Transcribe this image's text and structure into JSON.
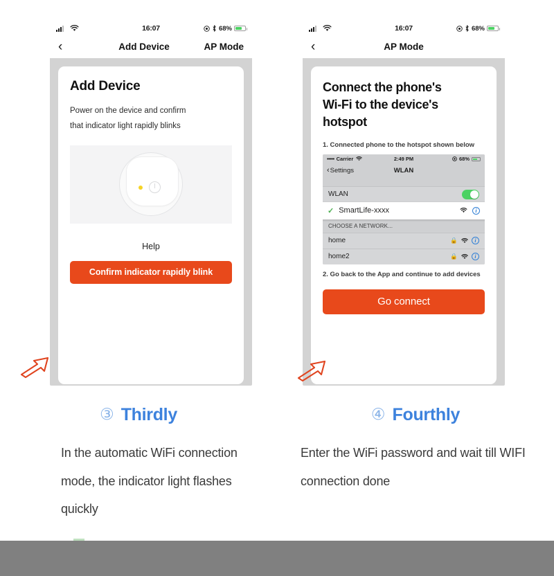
{
  "left_phone": {
    "status_bar": {
      "time": "16:07",
      "battery_text": "68%",
      "signal_icon": "signal-bars-icon",
      "wifi_icon": "wifi-icon",
      "location_icon": "location-icon",
      "bluetooth_icon": "bluetooth-icon",
      "battery_icon": "battery-icon"
    },
    "nav": {
      "back_icon": "chevron-left-icon",
      "title": "Add Device",
      "action": "AP Mode"
    },
    "card": {
      "title": "Add Device",
      "subtitle_line1": "Power on the device and confirm",
      "subtitle_line2": "that indicator light rapidly blinks",
      "device_image_alt": "smart-device-illustration",
      "help_label": "Help",
      "cta_label": "Confirm indicator rapidly blink"
    }
  },
  "right_phone": {
    "status_bar": {
      "time": "16:07",
      "battery_text": "68%",
      "signal_icon": "signal-bars-icon",
      "wifi_icon": "wifi-icon",
      "location_icon": "location-icon",
      "bluetooth_icon": "bluetooth-icon",
      "battery_icon": "battery-icon"
    },
    "nav": {
      "back_icon": "chevron-left-icon",
      "title": "AP Mode"
    },
    "card": {
      "title_line1": "Connect the phone's",
      "title_line2": "Wi-Fi to the device's",
      "title_line3": "hotspot",
      "step1": "1. Connected phone to the hotspot shown below",
      "step2": "2. Go back to the App and continue to add devices",
      "cta_label": "Go connect"
    },
    "wlan_mock": {
      "status_bar": {
        "carrier_dots": "•••••",
        "carrier": "Carrier",
        "time": "2:49 PM",
        "battery_text": "68%"
      },
      "nav": {
        "back_label": "Settings",
        "title": "WLAN"
      },
      "toggle_row": {
        "label": "WLAN",
        "state": "on"
      },
      "selected_network": {
        "name": "SmartLife-xxxx",
        "checked": true
      },
      "section_header": "CHOOSE A NETWORK...",
      "networks": [
        {
          "name": "home",
          "locked": true
        },
        {
          "name": "home2",
          "locked": true
        }
      ]
    }
  },
  "captions": {
    "left": {
      "number": "③",
      "word": "Thirdly",
      "body": "In the automatic WiFi connection mode, the indicator light flashes quickly"
    },
    "right": {
      "number": "④",
      "word": "Fourthly",
      "body": "Enter the WiFi password and wait till WIFI connection done"
    }
  },
  "annotations": {
    "arrow_left": "red-arrow-icon",
    "arrow_right": "red-arrow-icon"
  },
  "colors": {
    "cta_orange": "#e8491b",
    "caption_blue": "#3d82dd",
    "caption_number_blue": "#8ab4e8",
    "toggle_green": "#4cd263",
    "arrow_red": "#e0441f",
    "bottom_bar_gray": "#808080"
  }
}
